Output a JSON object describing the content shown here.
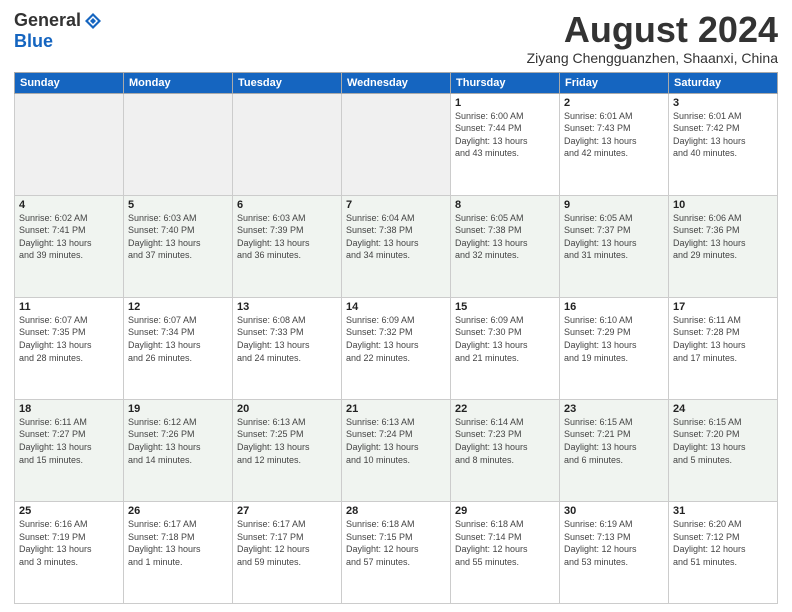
{
  "header": {
    "logo_general": "General",
    "logo_blue": "Blue",
    "month_title": "August 2024",
    "location": "Ziyang Chengguanzhen, Shaanxi, China"
  },
  "weekdays": [
    "Sunday",
    "Monday",
    "Tuesday",
    "Wednesday",
    "Thursday",
    "Friday",
    "Saturday"
  ],
  "weeks": [
    [
      {
        "day": "",
        "info": ""
      },
      {
        "day": "",
        "info": ""
      },
      {
        "day": "",
        "info": ""
      },
      {
        "day": "",
        "info": ""
      },
      {
        "day": "1",
        "info": "Sunrise: 6:00 AM\nSunset: 7:44 PM\nDaylight: 13 hours\nand 43 minutes."
      },
      {
        "day": "2",
        "info": "Sunrise: 6:01 AM\nSunset: 7:43 PM\nDaylight: 13 hours\nand 42 minutes."
      },
      {
        "day": "3",
        "info": "Sunrise: 6:01 AM\nSunset: 7:42 PM\nDaylight: 13 hours\nand 40 minutes."
      }
    ],
    [
      {
        "day": "4",
        "info": "Sunrise: 6:02 AM\nSunset: 7:41 PM\nDaylight: 13 hours\nand 39 minutes."
      },
      {
        "day": "5",
        "info": "Sunrise: 6:03 AM\nSunset: 7:40 PM\nDaylight: 13 hours\nand 37 minutes."
      },
      {
        "day": "6",
        "info": "Sunrise: 6:03 AM\nSunset: 7:39 PM\nDaylight: 13 hours\nand 36 minutes."
      },
      {
        "day": "7",
        "info": "Sunrise: 6:04 AM\nSunset: 7:38 PM\nDaylight: 13 hours\nand 34 minutes."
      },
      {
        "day": "8",
        "info": "Sunrise: 6:05 AM\nSunset: 7:38 PM\nDaylight: 13 hours\nand 32 minutes."
      },
      {
        "day": "9",
        "info": "Sunrise: 6:05 AM\nSunset: 7:37 PM\nDaylight: 13 hours\nand 31 minutes."
      },
      {
        "day": "10",
        "info": "Sunrise: 6:06 AM\nSunset: 7:36 PM\nDaylight: 13 hours\nand 29 minutes."
      }
    ],
    [
      {
        "day": "11",
        "info": "Sunrise: 6:07 AM\nSunset: 7:35 PM\nDaylight: 13 hours\nand 28 minutes."
      },
      {
        "day": "12",
        "info": "Sunrise: 6:07 AM\nSunset: 7:34 PM\nDaylight: 13 hours\nand 26 minutes."
      },
      {
        "day": "13",
        "info": "Sunrise: 6:08 AM\nSunset: 7:33 PM\nDaylight: 13 hours\nand 24 minutes."
      },
      {
        "day": "14",
        "info": "Sunrise: 6:09 AM\nSunset: 7:32 PM\nDaylight: 13 hours\nand 22 minutes."
      },
      {
        "day": "15",
        "info": "Sunrise: 6:09 AM\nSunset: 7:30 PM\nDaylight: 13 hours\nand 21 minutes."
      },
      {
        "day": "16",
        "info": "Sunrise: 6:10 AM\nSunset: 7:29 PM\nDaylight: 13 hours\nand 19 minutes."
      },
      {
        "day": "17",
        "info": "Sunrise: 6:11 AM\nSunset: 7:28 PM\nDaylight: 13 hours\nand 17 minutes."
      }
    ],
    [
      {
        "day": "18",
        "info": "Sunrise: 6:11 AM\nSunset: 7:27 PM\nDaylight: 13 hours\nand 15 minutes."
      },
      {
        "day": "19",
        "info": "Sunrise: 6:12 AM\nSunset: 7:26 PM\nDaylight: 13 hours\nand 14 minutes."
      },
      {
        "day": "20",
        "info": "Sunrise: 6:13 AM\nSunset: 7:25 PM\nDaylight: 13 hours\nand 12 minutes."
      },
      {
        "day": "21",
        "info": "Sunrise: 6:13 AM\nSunset: 7:24 PM\nDaylight: 13 hours\nand 10 minutes."
      },
      {
        "day": "22",
        "info": "Sunrise: 6:14 AM\nSunset: 7:23 PM\nDaylight: 13 hours\nand 8 minutes."
      },
      {
        "day": "23",
        "info": "Sunrise: 6:15 AM\nSunset: 7:21 PM\nDaylight: 13 hours\nand 6 minutes."
      },
      {
        "day": "24",
        "info": "Sunrise: 6:15 AM\nSunset: 7:20 PM\nDaylight: 13 hours\nand 5 minutes."
      }
    ],
    [
      {
        "day": "25",
        "info": "Sunrise: 6:16 AM\nSunset: 7:19 PM\nDaylight: 13 hours\nand 3 minutes."
      },
      {
        "day": "26",
        "info": "Sunrise: 6:17 AM\nSunset: 7:18 PM\nDaylight: 13 hours\nand 1 minute."
      },
      {
        "day": "27",
        "info": "Sunrise: 6:17 AM\nSunset: 7:17 PM\nDaylight: 12 hours\nand 59 minutes."
      },
      {
        "day": "28",
        "info": "Sunrise: 6:18 AM\nSunset: 7:15 PM\nDaylight: 12 hours\nand 57 minutes."
      },
      {
        "day": "29",
        "info": "Sunrise: 6:18 AM\nSunset: 7:14 PM\nDaylight: 12 hours\nand 55 minutes."
      },
      {
        "day": "30",
        "info": "Sunrise: 6:19 AM\nSunset: 7:13 PM\nDaylight: 12 hours\nand 53 minutes."
      },
      {
        "day": "31",
        "info": "Sunrise: 6:20 AM\nSunset: 7:12 PM\nDaylight: 12 hours\nand 51 minutes."
      }
    ]
  ]
}
